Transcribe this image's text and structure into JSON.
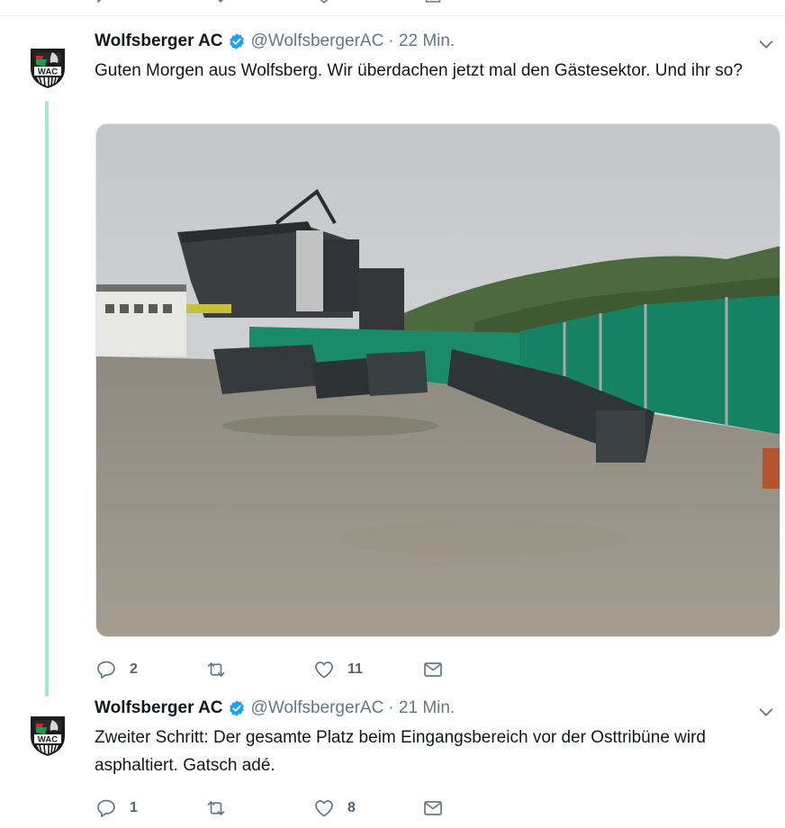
{
  "colors": {
    "verified": "#1da1f2",
    "thread_line": "#a5e6cf",
    "secondary_text": "#657786",
    "icon": "#657786"
  },
  "tweets": [
    {
      "author_name": "Wolfsberger AC",
      "handle": "@WolfsbergerAC",
      "time": "· 22 Min.",
      "text": "Guten Morgen aus Wolfsberg. Wir überdachen jetzt mal den Gästesektor. Und ihr so?",
      "logo_text": "WAC",
      "media_alt": "stadium construction site photo",
      "reply_count": "2",
      "retweet_count": "",
      "like_count": "11"
    },
    {
      "author_name": "Wolfsberger AC",
      "handle": "@WolfsbergerAC",
      "time": "· 21 Min.",
      "text": "Zweiter Schritt: Der gesamte Platz beim Eingangsbereich vor der Osttribüne wird asphaltiert. Gatsch adé.",
      "logo_text": "WAC",
      "reply_count": "1",
      "retweet_count": "",
      "like_count": "8"
    }
  ]
}
